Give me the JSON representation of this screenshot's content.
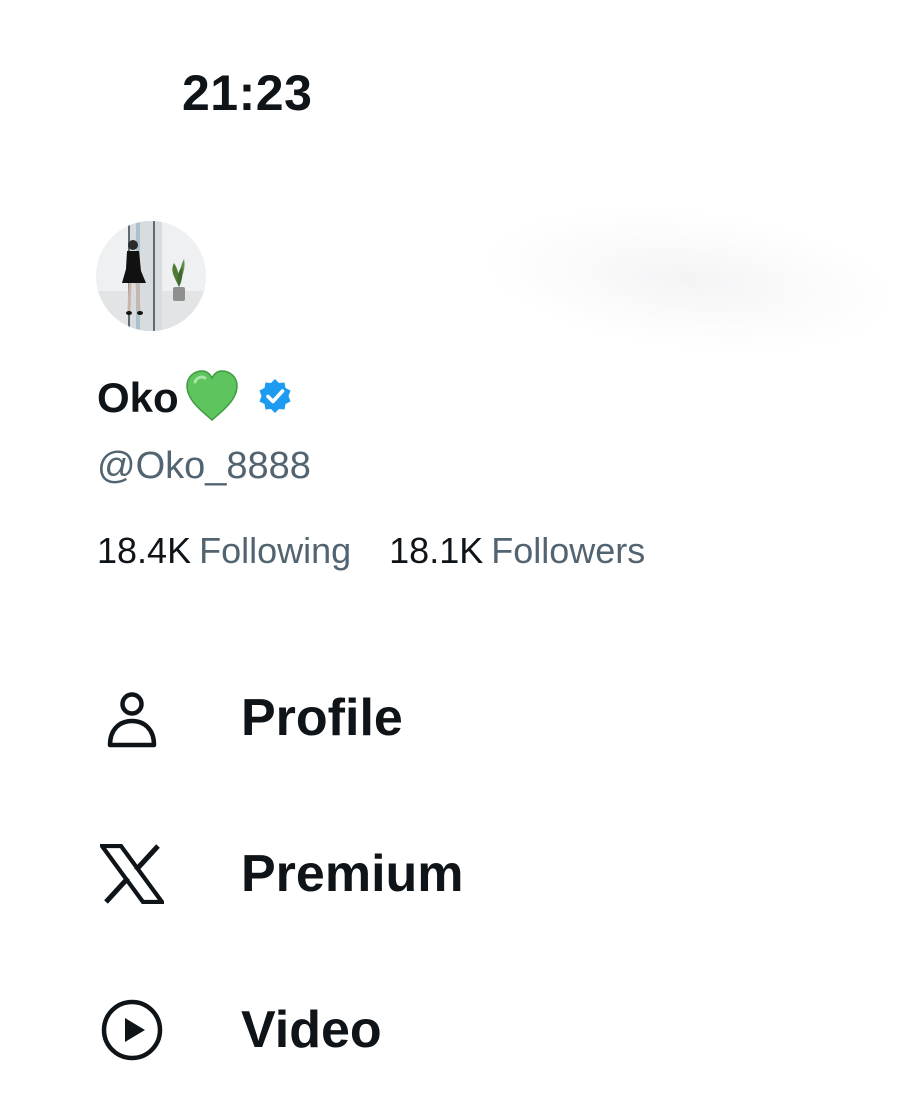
{
  "status_bar": {
    "time": "21:23"
  },
  "profile": {
    "display_name": "Oko",
    "handle": "@Oko_8888",
    "name_emoji_icon": "green-heart-icon",
    "verified_icon": "verified-badge-icon",
    "stats": [
      {
        "count": "18.4K",
        "label": "Following"
      },
      {
        "count": "18.1K",
        "label": "Followers"
      }
    ]
  },
  "menu": {
    "items": [
      {
        "label": "Profile",
        "icon": "person-icon"
      },
      {
        "label": "Premium",
        "icon": "x-logo-icon"
      },
      {
        "label": "Video",
        "icon": "play-circle-icon"
      }
    ]
  },
  "colors": {
    "text_primary": "#0f1419",
    "text_secondary": "#536471",
    "verified_blue": "#1d9bf0",
    "heart_green": "#5ec45e"
  }
}
